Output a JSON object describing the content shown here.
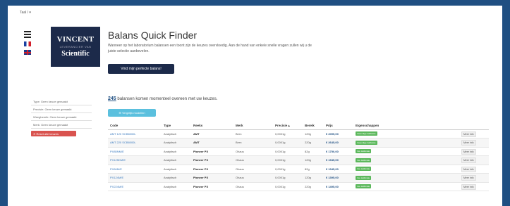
{
  "header": {
    "toplabel": "Taal / ▾"
  },
  "logo": {
    "line1": "VINCENT",
    "line2": "LEVERANCIER VAN",
    "line3": "Scientific"
  },
  "hero": {
    "title": "Balans Quick Finder",
    "intro": "Wanneer op het laboratorium balansen een toont zijn de keuzes overvloedig. Aan de hand van enkele snelle vragen zullen wij u de juiste selectie aanbevelen.",
    "cta": "Vind mijn perfecte balans!"
  },
  "filters": {
    "items": [
      "Type: Geen keuze gemaakt",
      "Precisie: Geen keuze gemaakt",
      "Weegbereik: Geen keuze gemaakt",
      "Merk: Geen keuze gemaakt"
    ],
    "reset": "✕ Reset alle keuzes"
  },
  "results": {
    "count": "245",
    "count_text": " balansen komen momenteel overeen met uw keuzes.",
    "compare_btn": "☰ Vergelijk modellen"
  },
  "table": {
    "headers": [
      "Code",
      "Type",
      "Reeks",
      "Merk",
      "Precisie ▴",
      "Bereik",
      "Prijs",
      "Eigenschappen",
      ""
    ],
    "rows": [
      [
        "AMT 120 SCB8000L",
        "Analytisch",
        "AMT",
        "Bern",
        "0,0001g",
        "120g",
        "€ 2095,00",
        "Inwendige kalibratie",
        "Meer info"
      ],
      [
        "AMT 220 SCB8000L",
        "Analytisch",
        "AMT",
        "Bern",
        "0,0001g",
        "220g",
        "€ 2645,00",
        "Inwendige kalibratie",
        "Meer info"
      ],
      [
        "PX85NM/E",
        "Analytisch",
        "Pioneer PX",
        "Ohaus",
        "0,0001g",
        "82g",
        "€ 1750,00",
        "Inw. kalibratie",
        "Meer info"
      ],
      [
        "PX125DM/E",
        "Analytisch",
        "Pioneer PX",
        "Ohaus",
        "0,0001g",
        "120g",
        "€ 1945,00",
        "Inw. kalibratie",
        "Meer info"
      ],
      [
        "PX84M/E",
        "Analytisch",
        "Pioneer PX",
        "Ohaus",
        "0,0001g",
        "82g",
        "€ 1345,00",
        "Inw. kalibratie",
        "Meer info"
      ],
      [
        "PX124M/E",
        "Analytisch",
        "Pioneer PX",
        "Ohaus",
        "0,0001g",
        "120g",
        "€ 1395,00",
        "Inw. kalibratie",
        "Meer info"
      ],
      [
        "PX224M/E",
        "Analytisch",
        "Pioneer PX",
        "Ohaus",
        "0,0001g",
        "220g",
        "€ 1495,00",
        "Inw. kalibratie",
        "Meer info"
      ]
    ]
  }
}
